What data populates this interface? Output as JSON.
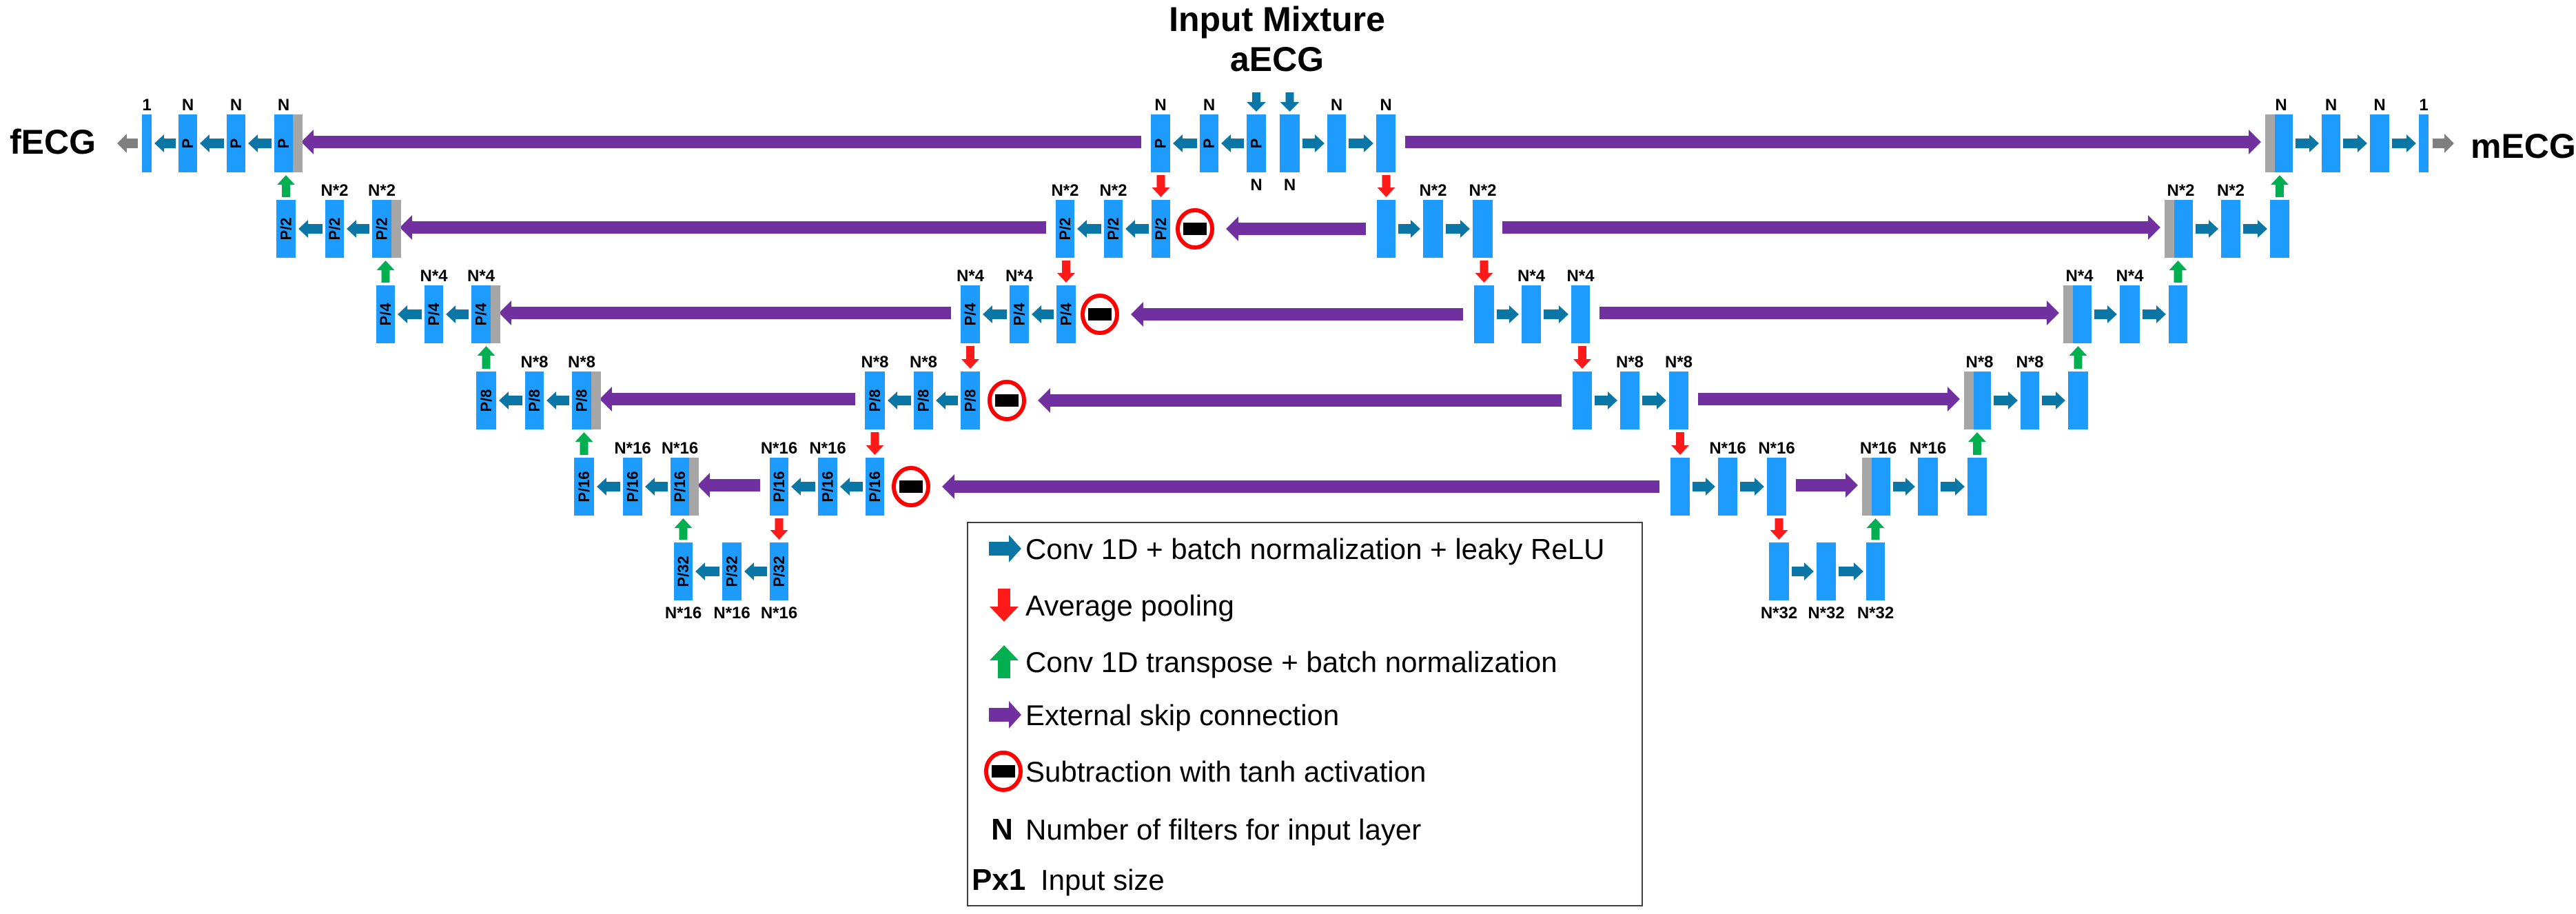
{
  "title": {
    "line1": "Input Mixture",
    "line2": "aECG"
  },
  "outputs": {
    "left": "fECG",
    "right": "mECG"
  },
  "colors": {
    "block": "#1e9bff",
    "concat": "#a6a6a6",
    "conv_arrow": "#0a76a6",
    "pool_arrow": "#ff1a1a",
    "upsample_arrow": "#00b050",
    "skip_arrow": "#7030a0",
    "output_arrow": "#7f7f7f",
    "subtract_ring": "#ff0000",
    "subtract_bar": "#000000"
  },
  "blocks": [
    {
      "id": "L1a",
      "filters": "1",
      "size": "",
      "concat": false,
      "output": true
    },
    {
      "id": "L1b",
      "filters": "N",
      "size": "P"
    },
    {
      "id": "L1c",
      "filters": "N",
      "size": "P"
    },
    {
      "id": "L1d",
      "filters": "N",
      "size": "P",
      "concat": true
    },
    {
      "id": "C1a",
      "filters": "N",
      "size": "P"
    },
    {
      "id": "C1b",
      "filters": "N",
      "size": "P"
    },
    {
      "id": "C1c",
      "filters": "",
      "size": "P",
      "below": "N"
    },
    {
      "id": "C1d",
      "filters": "",
      "size": "",
      "below": "N"
    },
    {
      "id": "C1e",
      "filters": "N",
      "size": ""
    },
    {
      "id": "C1f",
      "filters": "N",
      "size": ""
    },
    {
      "id": "R1a",
      "filters": "N",
      "size": "",
      "concat": true
    },
    {
      "id": "R1b",
      "filters": "N",
      "size": ""
    },
    {
      "id": "R1c",
      "filters": "N",
      "size": ""
    },
    {
      "id": "R1d",
      "filters": "1",
      "size": "",
      "output": true
    },
    {
      "id": "L2a",
      "filters": "",
      "size": "P/2"
    },
    {
      "id": "L2b",
      "filters": "N*2",
      "size": "P/2"
    },
    {
      "id": "L2c",
      "filters": "N*2",
      "size": "P/2",
      "concat": true
    },
    {
      "id": "C2a",
      "filters": "N*2",
      "size": "P/2"
    },
    {
      "id": "C2b",
      "filters": "N*2",
      "size": "P/2"
    },
    {
      "id": "C2c",
      "filters": "",
      "size": "P/2"
    },
    {
      "id": "D2a",
      "filters": "",
      "size": ""
    },
    {
      "id": "D2b",
      "filters": "N*2",
      "size": ""
    },
    {
      "id": "D2c",
      "filters": "N*2",
      "size": ""
    },
    {
      "id": "R2a",
      "filters": "N*2",
      "size": "",
      "concat": true
    },
    {
      "id": "R2b",
      "filters": "N*2",
      "size": ""
    },
    {
      "id": "R2c",
      "filters": "",
      "size": ""
    },
    {
      "id": "L3a",
      "filters": "",
      "size": "P/4"
    },
    {
      "id": "L3b",
      "filters": "N*4",
      "size": "P/4"
    },
    {
      "id": "L3c",
      "filters": "N*4",
      "size": "P/4",
      "concat": true
    },
    {
      "id": "C3a",
      "filters": "N*4",
      "size": "P/4"
    },
    {
      "id": "C3b",
      "filters": "N*4",
      "size": "P/4"
    },
    {
      "id": "C3c",
      "filters": "",
      "size": "P/4"
    },
    {
      "id": "D3a",
      "filters": "",
      "size": ""
    },
    {
      "id": "D3b",
      "filters": "N*4",
      "size": ""
    },
    {
      "id": "D3c",
      "filters": "N*4",
      "size": ""
    },
    {
      "id": "R3a",
      "filters": "N*4",
      "size": "",
      "concat": true
    },
    {
      "id": "R3b",
      "filters": "N*4",
      "size": ""
    },
    {
      "id": "R3c",
      "filters": "",
      "size": ""
    },
    {
      "id": "L4a",
      "filters": "",
      "size": "P/8"
    },
    {
      "id": "L4b",
      "filters": "N*8",
      "size": "P/8"
    },
    {
      "id": "L4c",
      "filters": "N*8",
      "size": "P/8",
      "concat": true
    },
    {
      "id": "C4a",
      "filters": "N*8",
      "size": "P/8"
    },
    {
      "id": "C4b",
      "filters": "N*8",
      "size": "P/8"
    },
    {
      "id": "C4c",
      "filters": "",
      "size": "P/8"
    },
    {
      "id": "D4a",
      "filters": "",
      "size": ""
    },
    {
      "id": "D4b",
      "filters": "N*8",
      "size": ""
    },
    {
      "id": "D4c",
      "filters": "N*8",
      "size": ""
    },
    {
      "id": "R4a",
      "filters": "N*8",
      "size": "",
      "concat": true
    },
    {
      "id": "R4b",
      "filters": "N*8",
      "size": ""
    },
    {
      "id": "R4c",
      "filters": "",
      "size": ""
    },
    {
      "id": "L5a",
      "filters": "",
      "size": "P/16"
    },
    {
      "id": "L5b",
      "filters": "N*16",
      "size": "P/16"
    },
    {
      "id": "L5c",
      "filters": "N*16",
      "size": "P/16",
      "concat": true
    },
    {
      "id": "C5a",
      "filters": "N*16",
      "size": "P/16"
    },
    {
      "id": "C5b",
      "filters": "N*16",
      "size": "P/16"
    },
    {
      "id": "C5c",
      "filters": "",
      "size": "P/16"
    },
    {
      "id": "D5a",
      "filters": "",
      "size": ""
    },
    {
      "id": "D5b",
      "filters": "N*16",
      "size": ""
    },
    {
      "id": "D5c",
      "filters": "N*16",
      "size": ""
    },
    {
      "id": "R5a",
      "filters": "N*16",
      "size": "",
      "concat": true
    },
    {
      "id": "R5b",
      "filters": "N*16",
      "size": ""
    },
    {
      "id": "R5c",
      "filters": "",
      "size": ""
    },
    {
      "id": "L6a",
      "filters": "",
      "size": "P/32",
      "below": "N*16"
    },
    {
      "id": "L6b",
      "filters": "",
      "size": "P/32",
      "below": "N*16"
    },
    {
      "id": "L6c",
      "filters": "",
      "size": "P/32",
      "below": "N*16"
    },
    {
      "id": "D6a",
      "filters": "",
      "size": "",
      "below": "N*32"
    },
    {
      "id": "D6b",
      "filters": "",
      "size": "",
      "below": "N*32"
    },
    {
      "id": "D6c",
      "filters": "",
      "size": "",
      "below": "N*32"
    }
  ],
  "connections": [
    {
      "type": "conv",
      "from": "L1b",
      "to": "L1a"
    },
    {
      "type": "conv",
      "from": "L1c",
      "to": "L1b"
    },
    {
      "type": "conv",
      "from": "L1d",
      "to": "L1c"
    },
    {
      "type": "conv",
      "from": "C1b",
      "to": "C1a"
    },
    {
      "type": "conv",
      "from": "C1c",
      "to": "C1b"
    },
    {
      "type": "conv",
      "from": "C1d",
      "to": "C1e"
    },
    {
      "type": "conv",
      "from": "C1e",
      "to": "C1f"
    },
    {
      "type": "conv",
      "from": "R1a",
      "to": "R1b"
    },
    {
      "type": "conv",
      "from": "R1b",
      "to": "R1c"
    },
    {
      "type": "conv",
      "from": "R1c",
      "to": "R1d"
    },
    {
      "type": "conv",
      "from": "L2b",
      "to": "L2a"
    },
    {
      "type": "conv",
      "from": "L2c",
      "to": "L2b"
    },
    {
      "type": "conv",
      "from": "C2b",
      "to": "C2a"
    },
    {
      "type": "conv",
      "from": "C2c",
      "to": "C2b"
    },
    {
      "type": "conv",
      "from": "D2a",
      "to": "D2b"
    },
    {
      "type": "conv",
      "from": "D2b",
      "to": "D2c"
    },
    {
      "type": "conv",
      "from": "R2a",
      "to": "R2b"
    },
    {
      "type": "conv",
      "from": "R2b",
      "to": "R2c"
    },
    {
      "type": "conv",
      "from": "L3b",
      "to": "L3a"
    },
    {
      "type": "conv",
      "from": "L3c",
      "to": "L3b"
    },
    {
      "type": "conv",
      "from": "C3b",
      "to": "C3a"
    },
    {
      "type": "conv",
      "from": "C3c",
      "to": "C3b"
    },
    {
      "type": "conv",
      "from": "D3a",
      "to": "D3b"
    },
    {
      "type": "conv",
      "from": "D3b",
      "to": "D3c"
    },
    {
      "type": "conv",
      "from": "R3a",
      "to": "R3b"
    },
    {
      "type": "conv",
      "from": "R3b",
      "to": "R3c"
    },
    {
      "type": "conv",
      "from": "L4b",
      "to": "L4a"
    },
    {
      "type": "conv",
      "from": "L4c",
      "to": "L4b"
    },
    {
      "type": "conv",
      "from": "C4b",
      "to": "C4a"
    },
    {
      "type": "conv",
      "from": "C4c",
      "to": "C4b"
    },
    {
      "type": "conv",
      "from": "D4a",
      "to": "D4b"
    },
    {
      "type": "conv",
      "from": "D4b",
      "to": "D4c"
    },
    {
      "type": "conv",
      "from": "R4a",
      "to": "R4b"
    },
    {
      "type": "conv",
      "from": "R4b",
      "to": "R4c"
    },
    {
      "type": "conv",
      "from": "L5b",
      "to": "L5a"
    },
    {
      "type": "conv",
      "from": "L5c",
      "to": "L5b"
    },
    {
      "type": "conv",
      "from": "C5b",
      "to": "C5a"
    },
    {
      "type": "conv",
      "from": "C5c",
      "to": "C5b"
    },
    {
      "type": "conv",
      "from": "D5a",
      "to": "D5b"
    },
    {
      "type": "conv",
      "from": "D5b",
      "to": "D5c"
    },
    {
      "type": "conv",
      "from": "R5a",
      "to": "R5b"
    },
    {
      "type": "conv",
      "from": "R5b",
      "to": "R5c"
    },
    {
      "type": "conv",
      "from": "L6b",
      "to": "L6a"
    },
    {
      "type": "conv",
      "from": "L6c",
      "to": "L6b"
    },
    {
      "type": "conv",
      "from": "D6a",
      "to": "D6b"
    },
    {
      "type": "conv",
      "from": "D6b",
      "to": "D6c"
    },
    {
      "type": "pool",
      "from": "C1a",
      "to": "C2c"
    },
    {
      "type": "pool",
      "from": "C2a",
      "to": "C3c"
    },
    {
      "type": "pool",
      "from": "C3a",
      "to": "C4c"
    },
    {
      "type": "pool",
      "from": "C4a",
      "to": "C5c"
    },
    {
      "type": "pool",
      "from": "C5a",
      "to": "L6c"
    },
    {
      "type": "pool",
      "from": "C1f",
      "to": "D2a"
    },
    {
      "type": "pool",
      "from": "D2c",
      "to": "D3a"
    },
    {
      "type": "pool",
      "from": "D3c",
      "to": "D4a"
    },
    {
      "type": "pool",
      "from": "D4c",
      "to": "D5a"
    },
    {
      "type": "pool",
      "from": "D5c",
      "to": "D6a"
    },
    {
      "type": "upsample",
      "from": "L2a",
      "to": "L1d"
    },
    {
      "type": "upsample",
      "from": "L3a",
      "to": "L2c"
    },
    {
      "type": "upsample",
      "from": "L4a",
      "to": "L3c"
    },
    {
      "type": "upsample",
      "from": "L5a",
      "to": "L4c"
    },
    {
      "type": "upsample",
      "from": "L6a",
      "to": "L5c"
    },
    {
      "type": "upsample",
      "from": "R2c",
      "to": "R1a"
    },
    {
      "type": "upsample",
      "from": "R3c",
      "to": "R2a"
    },
    {
      "type": "upsample",
      "from": "R4c",
      "to": "R3a"
    },
    {
      "type": "upsample",
      "from": "R5c",
      "to": "R4a"
    },
    {
      "type": "upsample",
      "from": "D6c",
      "to": "R5a"
    },
    {
      "type": "skip",
      "from": "C1a",
      "to": "L1d"
    },
    {
      "type": "skip",
      "from": "C1f",
      "to": "R1a"
    },
    {
      "type": "skip",
      "from": "C2a",
      "to": "L2c"
    },
    {
      "type": "skip",
      "from": "D2c",
      "to": "R2a"
    },
    {
      "type": "skip",
      "from": "C3a",
      "to": "L3c"
    },
    {
      "type": "skip",
      "from": "D3c",
      "to": "R3a"
    },
    {
      "type": "skip",
      "from": "C4a",
      "to": "L4c"
    },
    {
      "type": "skip",
      "from": "D4c",
      "to": "R4a"
    },
    {
      "type": "skip",
      "from": "C5a",
      "to": "L5c"
    },
    {
      "type": "skip",
      "from": "D5c",
      "to": "R5a"
    },
    {
      "type": "skip",
      "from": "D2a",
      "to": "C2c",
      "via": "subtract"
    },
    {
      "type": "skip",
      "from": "D3a",
      "to": "C3c",
      "via": "subtract"
    },
    {
      "type": "skip",
      "from": "D4a",
      "to": "C4c",
      "via": "subtract"
    },
    {
      "type": "skip",
      "from": "D5a",
      "to": "C5c",
      "via": "subtract"
    },
    {
      "type": "input",
      "to": "C1c"
    },
    {
      "type": "input",
      "to": "C1d"
    },
    {
      "type": "output",
      "from": "L1a",
      "to": "fECG"
    },
    {
      "type": "output",
      "from": "R1d",
      "to": "mECG"
    }
  ],
  "legend": [
    {
      "icon": "conv-arrow-icon",
      "label": "Conv 1D + batch normalization + leaky ReLU"
    },
    {
      "icon": "pool-arrow-icon",
      "label": "Average pooling"
    },
    {
      "icon": "upsample-arrow-icon",
      "label": "Conv 1D transpose + batch normalization"
    },
    {
      "icon": "skip-arrow-icon",
      "label": "External skip connection"
    },
    {
      "icon": "subtract-icon",
      "label": "Subtraction with tanh activation"
    },
    {
      "icon": "symbol",
      "symbol": "N",
      "label": "Number of filters for input layer"
    },
    {
      "icon": "symbol",
      "symbol": "Px1",
      "label": "Input size"
    }
  ]
}
